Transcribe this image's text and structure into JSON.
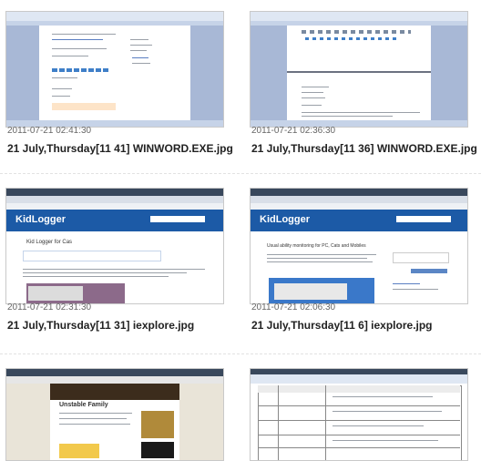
{
  "items": [
    {
      "timestamp": "2011-07-21 02:41:30",
      "filename": "21 July,Thursday[11 41] WINWORD.EXE.jpg"
    },
    {
      "timestamp": "2011-07-21 02:36:30",
      "filename": "21 July,Thursday[11 36] WINWORD.EXE.jpg"
    },
    {
      "timestamp": "2011-07-21 02:31:30",
      "filename": "21 July,Thursday[11 31] iexplore.jpg"
    },
    {
      "timestamp": "2011-07-21 02:06:30",
      "filename": "21 July,Thursday[11 6] iexplore.jpg"
    }
  ],
  "thumbs": {
    "kidlogger_logo": "KidLogger",
    "page1_heading": "Kid Logger for Cas",
    "page2_heading": "Usual ability monitoring for PC, Cats and Mobiles",
    "blog_title": "Unstable Family"
  },
  "colors": {
    "word_blue": "#a8b8d6",
    "ie_blue": "#1c5aa6"
  }
}
